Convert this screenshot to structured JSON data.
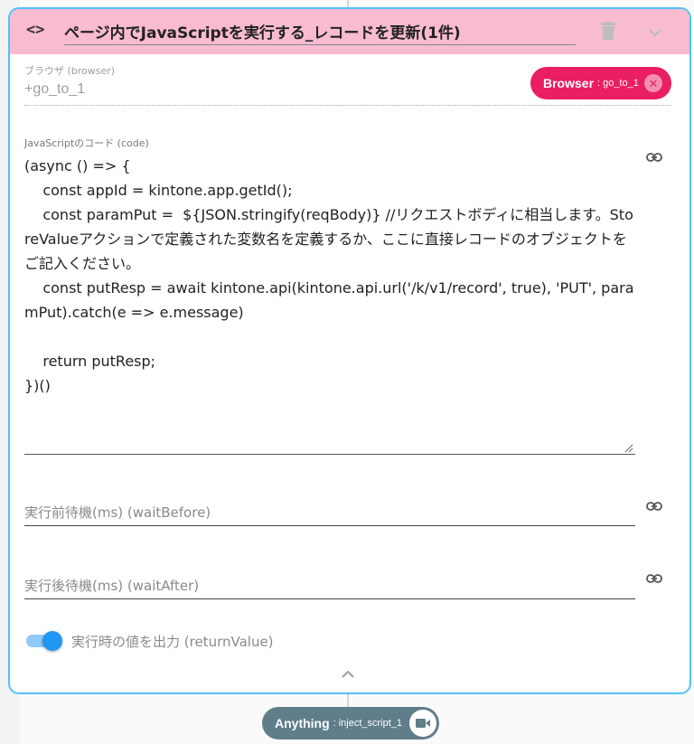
{
  "header": {
    "code_icon": "code-brackets-icon",
    "title": "ページ内でJavaScriptを実行する_レコードを更新(1件)",
    "delete_icon": "trash-icon",
    "expand_icon": "chevron-down-icon"
  },
  "browser_field": {
    "label": "ブラウザ (browser)",
    "value": "+go_to_1",
    "chip": {
      "type": "Browser",
      "separator": ":",
      "value": "go_to_1",
      "remove_icon": "close-circle-icon"
    }
  },
  "code_field": {
    "label": "JavaScriptのコード (code)",
    "value": "(async () => {\n    const appId = kintone.app.getId();\n    const paramPut =  ${JSON.stringify(reqBody)} //リクエストボディに相当します。StoreValueアクションで定義された変数名を定義するか、ここに直接レコードのオブジェクトをご記入ください。\n    const putResp = await kintone.api(kintone.api.url('/k/v1/record', true), 'PUT', paramPut).catch(e => e.message)\n\n    return putResp;\n})()",
    "link_icon": "link-icon"
  },
  "wait_before": {
    "label": "実行前待機(ms) (waitBefore)",
    "value": "",
    "link_icon": "link-icon"
  },
  "wait_after": {
    "label": "実行後待機(ms) (waitAfter)",
    "value": "",
    "link_icon": "link-icon"
  },
  "return_value": {
    "label": "実行時の値を出力 (returnValue)",
    "enabled": true
  },
  "collapse_icon": "chevron-up-icon",
  "output_chip": {
    "type": "Anything",
    "separator": ":",
    "value": "inject_script_1",
    "record_icon": "video-camera-icon"
  },
  "colors": {
    "header_bg": "#f8bbd0",
    "card_border": "#4fc3f7",
    "browser_chip": "#e91e63",
    "output_chip": "#607d8b",
    "toggle_on": "#2196f3"
  }
}
